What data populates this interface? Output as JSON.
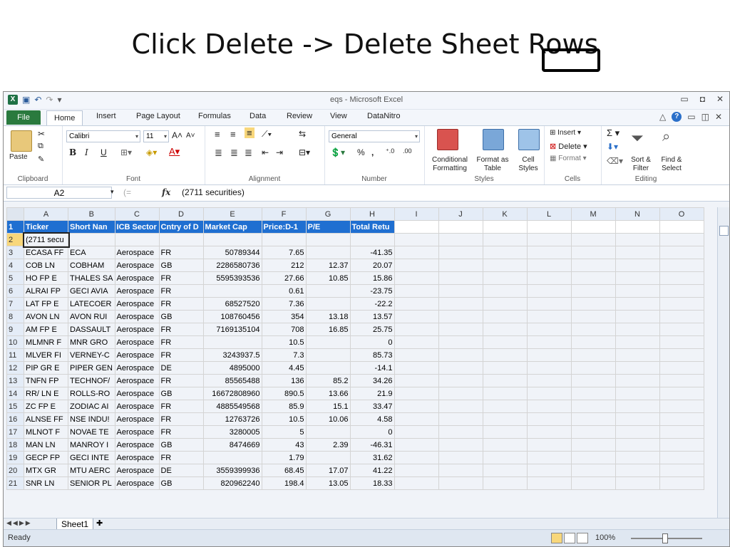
{
  "slide": {
    "title": "Click Delete -> Delete Sheet Rows"
  },
  "window": {
    "title": "eqs - Microsoft Excel"
  },
  "tabs": [
    "File",
    "Home",
    "Insert",
    "Page Layout",
    "Formulas",
    "Data",
    "Review",
    "View",
    "DataNitro"
  ],
  "ribbon": {
    "clipboard": {
      "paste": "Paste",
      "label": "Clipboard"
    },
    "font": {
      "name": "Calibri",
      "size": "11",
      "bold": "B",
      "italic": "I",
      "underline": "U",
      "label": "Font"
    },
    "alignment": {
      "label": "Alignment"
    },
    "number": {
      "format": "General",
      "percent": "%",
      "comma": ",",
      "label": "Number"
    },
    "styles": {
      "conditional": "Conditional Formatting",
      "format_table": "Format as Table",
      "cell_styles": "Cell Styles",
      "label": "Styles"
    },
    "cells": {
      "insert": "Insert",
      "delete": "Delete",
      "format": "Format",
      "label": "Cells"
    },
    "editing": {
      "sigma": "Σ",
      "sort": "Sort & Filter",
      "find": "Find & Select",
      "label": "Editing"
    }
  },
  "formula_bar": {
    "name_box": "A2",
    "fx": "fx",
    "value": "(2711 securities)"
  },
  "columns": [
    "A",
    "B",
    "C",
    "D",
    "E",
    "F",
    "G",
    "H",
    "I",
    "J",
    "K",
    "L",
    "M",
    "N",
    "O"
  ],
  "rows": [
    {
      "n": "1",
      "cells": [
        "Ticker",
        "Short Nan",
        "ICB Sector",
        "Cntry of D",
        "Market Cap",
        "Price:D-1",
        "P/E",
        "Total Retu"
      ]
    },
    {
      "n": "2",
      "cells": [
        "(2711 secu",
        "",
        "",
        "",
        "",
        "",
        "",
        ""
      ]
    },
    {
      "n": "3",
      "cells": [
        "ECASA  FF",
        "ECA",
        "Aerospace",
        "FR",
        "50789344",
        "7.65",
        "",
        "-41.35"
      ]
    },
    {
      "n": "4",
      "cells": [
        "COB    LN",
        "COBHAM",
        "Aerospace",
        "GB",
        "2286580736",
        "212",
        "12.37",
        "20.07"
      ]
    },
    {
      "n": "5",
      "cells": [
        "HO     FP E",
        "THALES SA",
        "Aerospace",
        "FR",
        "5595393536",
        "27.66",
        "10.85",
        "15.86"
      ]
    },
    {
      "n": "6",
      "cells": [
        "ALRAI  FP",
        "GECI AVIA",
        "Aerospace",
        "FR",
        "",
        "0.61",
        "",
        "-23.75"
      ]
    },
    {
      "n": "7",
      "cells": [
        "LAT    FP E",
        "LATECOER",
        "Aerospace",
        "FR",
        "68527520",
        "7.36",
        "",
        "-22.2"
      ]
    },
    {
      "n": "8",
      "cells": [
        "AVON   LN",
        "AVON RUI",
        "Aerospace",
        "GB",
        "108760456",
        "354",
        "13.18",
        "13.57"
      ]
    },
    {
      "n": "9",
      "cells": [
        "AM     FP E",
        "DASSAULT",
        "Aerospace",
        "FR",
        "7169135104",
        "708",
        "16.85",
        "25.75"
      ]
    },
    {
      "n": "10",
      "cells": [
        "MLMNR  F",
        "MNR GRO",
        "Aerospace",
        "FR",
        "",
        "10.5",
        "",
        "0"
      ]
    },
    {
      "n": "11",
      "cells": [
        "MLVER  FI",
        "VERNEY-C",
        "Aerospace",
        "FR",
        "3243937.5",
        "7.3",
        "",
        "85.73"
      ]
    },
    {
      "n": "12",
      "cells": [
        "PIP    GR E",
        "PIPER GEN",
        "Aerospace",
        "DE",
        "4895000",
        "4.45",
        "",
        "-14.1"
      ]
    },
    {
      "n": "13",
      "cells": [
        "TNFN   FP",
        "TECHNOF/",
        "Aerospace",
        "FR",
        "85565488",
        "136",
        "85.2",
        "34.26"
      ]
    },
    {
      "n": "14",
      "cells": [
        "RR/    LN E",
        "ROLLS-RO",
        "Aerospace",
        "GB",
        "16672808960",
        "890.5",
        "13.66",
        "21.9"
      ]
    },
    {
      "n": "15",
      "cells": [
        "ZC     FP E",
        "ZODIAC AI",
        "Aerospace",
        "FR",
        "4885549568",
        "85.9",
        "15.1",
        "33.47"
      ]
    },
    {
      "n": "16",
      "cells": [
        "ALNSE  FF",
        "NSE INDU!",
        "Aerospace",
        "FR",
        "12763726",
        "10.5",
        "10.06",
        "4.58"
      ]
    },
    {
      "n": "17",
      "cells": [
        "MLNOT  F",
        "NOVAE TE",
        "Aerospace",
        "FR",
        "3280005",
        "5",
        "",
        "0"
      ]
    },
    {
      "n": "18",
      "cells": [
        "MAN    LN",
        "MANROY I",
        "Aerospace",
        "GB",
        "8474669",
        "43",
        "2.39",
        "-46.31"
      ]
    },
    {
      "n": "19",
      "cells": [
        "GECP   FP",
        "GECI INTE",
        "Aerospace",
        "FR",
        "",
        "1.79",
        "",
        "31.62"
      ]
    },
    {
      "n": "20",
      "cells": [
        "MTX    GR",
        "MTU AERC",
        "Aerospace",
        "DE",
        "3559399936",
        "68.45",
        "17.07",
        "41.22"
      ]
    },
    {
      "n": "21",
      "cells": [
        "SNR    LN",
        "SENIOR PL",
        "Aerospace",
        "GB",
        "820962240",
        "198.4",
        "13.05",
        "18.33"
      ]
    }
  ],
  "sheet_tab": "Sheet1",
  "status": {
    "ready": "Ready",
    "zoom": "100%"
  }
}
